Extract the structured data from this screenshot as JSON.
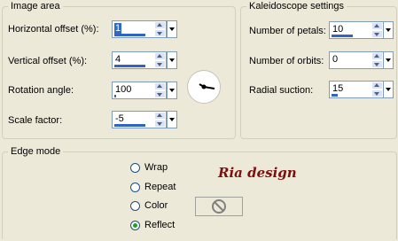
{
  "image_area": {
    "title": "Image area",
    "fields": [
      {
        "label": "Horizontal offset (%):",
        "value": "1",
        "fill": 0.8
      },
      {
        "label": "Vertical offset (%):",
        "value": "4",
        "fill": 0.8
      },
      {
        "label": "Rotation angle:",
        "value": "100",
        "fill": 0.05
      },
      {
        "label": "Scale factor:",
        "value": "-5",
        "fill": 0.8
      }
    ]
  },
  "kaleidoscope": {
    "title": "Kaleidoscope settings",
    "fields": [
      {
        "label": "Number of petals:",
        "value": "10",
        "fill": 0.55
      },
      {
        "label": "Number of orbits:",
        "value": "0",
        "fill": 0.0
      },
      {
        "label": "Radial suction:",
        "value": "15",
        "fill": 0.15
      }
    ]
  },
  "edge_mode": {
    "title": "Edge mode",
    "options": [
      "Wrap",
      "Repeat",
      "Color",
      "Reflect"
    ],
    "selected": "Reflect"
  },
  "watermark": "Ria design"
}
